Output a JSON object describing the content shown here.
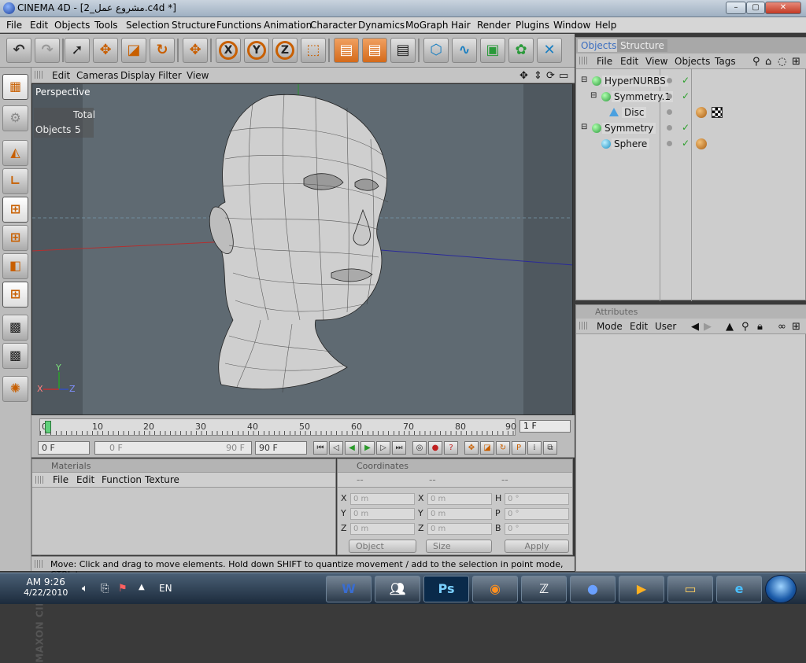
{
  "window": {
    "title": "CINEMA 4D - [2_مشروع عمل.c4d *]",
    "minimize": "–",
    "maximize": "▢",
    "close": "✕"
  },
  "menu": [
    "File",
    "Edit",
    "Objects",
    "Tools",
    "Selection",
    "Structure",
    "Functions",
    "Animation",
    "Character",
    "Dynamics",
    "MoGraph",
    "Hair",
    "Render",
    "Plugins",
    "Window",
    "Help"
  ],
  "toolbar_icons": [
    "undo-icon",
    "redo-icon",
    "live-select-icon",
    "move-icon",
    "scale-icon",
    "rotate-icon",
    "move-axis-icon",
    "x-axis-lock-icon",
    "y-axis-lock-icon",
    "z-axis-lock-icon",
    "coordinate-system-icon",
    "render-view-icon",
    "render-picture-viewer-icon",
    "render-settings-icon",
    "cube-object-icon",
    "spline-icon",
    "nurbs-icon",
    "array-icon",
    "deformer-icon"
  ],
  "toolbar_axes": {
    "x": "X",
    "y": "Y",
    "z": "Z"
  },
  "viewport": {
    "menu": [
      "Edit",
      "Cameras",
      "Display",
      "Filter",
      "View"
    ],
    "camera_label": "Perspective",
    "stats_header": "Total",
    "stats_label": "Objects",
    "stats_value": "5",
    "axis_y": "Y",
    "axis_x": "X",
    "axis_z": "Z"
  },
  "timeline": {
    "ticks": [
      "0",
      "10",
      "20",
      "30",
      "40",
      "50",
      "60",
      "70",
      "80",
      "90"
    ],
    "current_frame": "1 F",
    "start_frame": "0 F",
    "range_start": "0 F",
    "range_end": "90 F",
    "end_frame": "90 F"
  },
  "materials": {
    "title": "Materials",
    "menu": [
      "File",
      "Edit",
      "Function",
      "Texture"
    ]
  },
  "coordinates": {
    "title": "Coordinates",
    "col_headers": [
      "--",
      "--",
      "--"
    ],
    "rows": [
      {
        "a": "X",
        "av": "0 m",
        "b": "X",
        "bv": "0 m",
        "c": "H",
        "cv": "0 °"
      },
      {
        "a": "Y",
        "av": "0 m",
        "b": "Y",
        "bv": "0 m",
        "c": "P",
        "cv": "0 °"
      },
      {
        "a": "Z",
        "av": "0 m",
        "b": "Z",
        "bv": "0 m",
        "c": "B",
        "cv": "0 °"
      }
    ],
    "mode1": "Object",
    "mode2": "Size",
    "apply": "Apply"
  },
  "status": "Move: Click and drag to move elements. Hold down SHIFT to quantize movement / add to the selection in point mode, CTRL to remove.",
  "objects_panel": {
    "tabs": [
      "Objects",
      "Structure"
    ],
    "menu": [
      "File",
      "Edit",
      "View",
      "Objects",
      "Tags"
    ],
    "items": [
      {
        "name": "HyperNURBS",
        "depth": 0,
        "icon": "hypernurbs-icon"
      },
      {
        "name": "Symmetry.1",
        "depth": 1,
        "icon": "symmetry-icon"
      },
      {
        "name": "Disc",
        "depth": 2,
        "icon": "disc-icon"
      },
      {
        "name": "Symmetry",
        "depth": 0,
        "icon": "symmetry-icon"
      },
      {
        "name": "Sphere",
        "depth": 1,
        "icon": "sphere-icon"
      }
    ]
  },
  "attributes_panel": {
    "title": "Attributes",
    "menu": [
      "Mode",
      "Edit",
      "User"
    ]
  },
  "taskbar": {
    "time": "AM 9:26",
    "date": "4/22/2010",
    "language": "EN",
    "apps": [
      "word-icon",
      "messenger-icon",
      "photoshop-icon",
      "firefox-icon",
      "zbrush-icon",
      "cinema4d-icon",
      "media-player-icon",
      "folder-icon",
      "internet-explorer-icon"
    ],
    "photoshop_label": "Ps",
    "word_label": "W"
  },
  "colors": {
    "accent_orange": "#c85f00",
    "selection_blue": "#3a6dbf",
    "check_green": "#2aa02a"
  }
}
